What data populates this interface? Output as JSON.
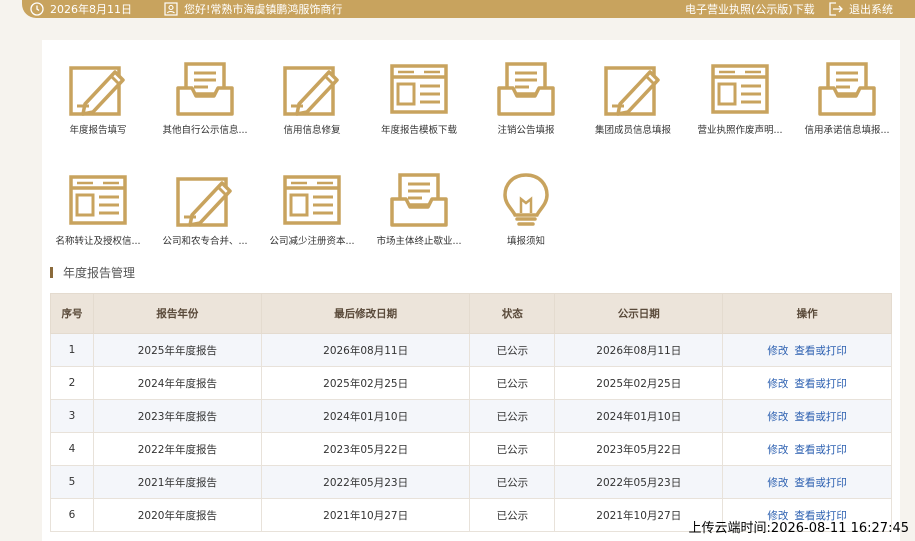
{
  "header": {
    "date": "2026年8月11日",
    "greeting": "您好!常熟市海虞镇鹏鸿服饰商行",
    "license_download": "电子营业执照(公示版)下载",
    "logout": "退出系统"
  },
  "tiles": [
    {
      "label": "年度报告填写",
      "icon": "pencil-edit-icon"
    },
    {
      "label": "其他自行公示信息...",
      "icon": "inbox-tray-icon"
    },
    {
      "label": "信用信息修复",
      "icon": "pencil-edit-icon"
    },
    {
      "label": "年度报告模板下载",
      "icon": "form-window-icon"
    },
    {
      "label": "注销公告填报",
      "icon": "inbox-tray-icon"
    },
    {
      "label": "集团成员信息填报",
      "icon": "pencil-edit-icon"
    },
    {
      "label": "营业执照作废声明...",
      "icon": "form-window-icon"
    },
    {
      "label": "信用承诺信息填报...",
      "icon": "inbox-tray-icon"
    },
    {
      "label": "名称转让及授权信...",
      "icon": "form-window-icon"
    },
    {
      "label": "公司和农专合并、...",
      "icon": "pencil-edit-icon"
    },
    {
      "label": "公司减少注册资本...",
      "icon": "form-window-icon"
    },
    {
      "label": "市场主体终止歇业...",
      "icon": "inbox-tray-icon"
    },
    {
      "label": "填报须知",
      "icon": "lightbulb-icon"
    }
  ],
  "section": {
    "title": "年度报告管理"
  },
  "table": {
    "headers": [
      "序号",
      "报告年份",
      "最后修改日期",
      "状态",
      "公示日期",
      "操作"
    ],
    "actions": {
      "edit": "修改",
      "view": "查看或打印"
    },
    "rows": [
      [
        "1",
        "2025年年度报告",
        "2026年08月11日",
        "已公示",
        "2026年08月11日"
      ],
      [
        "2",
        "2024年年度报告",
        "2025年02月25日",
        "已公示",
        "2025年02月25日"
      ],
      [
        "3",
        "2023年年度报告",
        "2024年01月10日",
        "已公示",
        "2024年01月10日"
      ],
      [
        "4",
        "2022年年度报告",
        "2023年05月22日",
        "已公示",
        "2023年05月22日"
      ],
      [
        "5",
        "2021年年度报告",
        "2022年05月23日",
        "已公示",
        "2022年05月23日"
      ],
      [
        "6",
        "2020年年度报告",
        "2021年10月27日",
        "已公示",
        "2021年10月27日"
      ]
    ]
  },
  "watermark": "上传云端时间:2026-08-11 16:27:45",
  "colors": {
    "accent": "#c8a35e",
    "link": "#2b5fb0",
    "header_bg": "#ece4da"
  }
}
